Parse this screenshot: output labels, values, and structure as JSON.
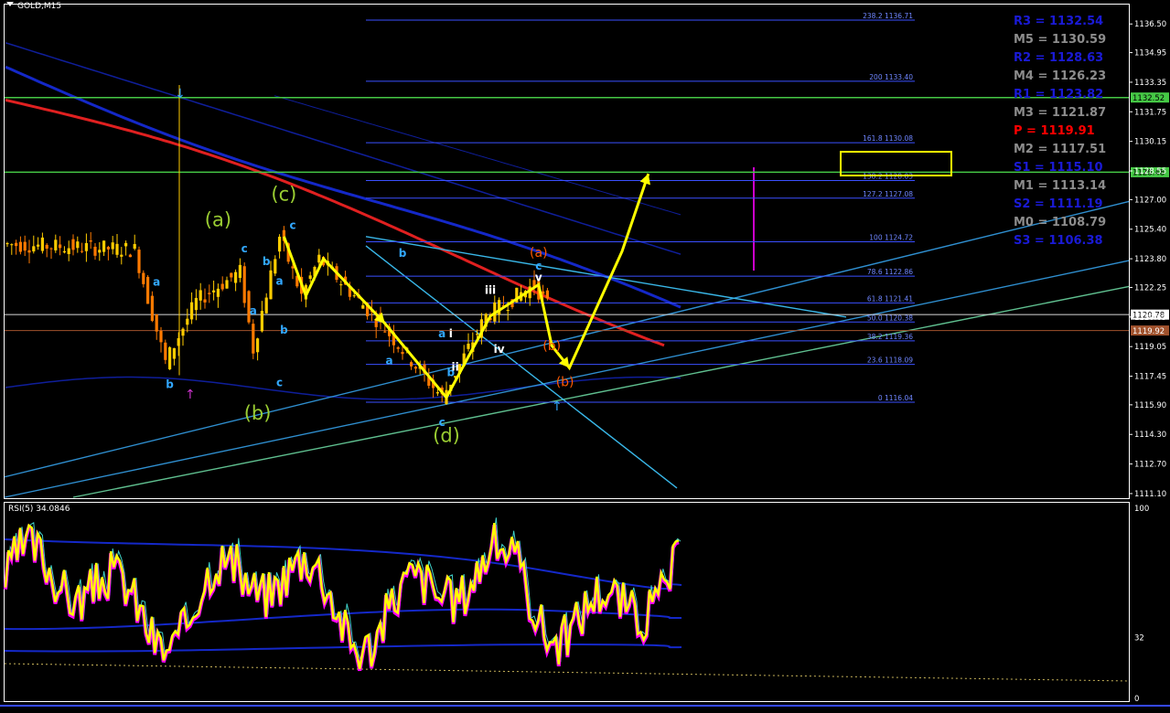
{
  "window": {
    "symbol_title": "GOLD,M15"
  },
  "colors": {
    "background": "#000000",
    "bull": "#ffcc00",
    "bear": "#ff7a00",
    "wave_path": "#ffff00",
    "ma_red": "#e02020",
    "ma_blue": "#1428c8",
    "fib": "#3a4fff",
    "channel": "#39b7e8",
    "green_level": "#45c845",
    "label_cyan": "#32a8ff",
    "label_green": "#9acd32",
    "label_orange": "#ff5a00",
    "rsi_main": "#ffff00",
    "rsi_magenta": "#ff00ff"
  },
  "chart_data": [
    {
      "type": "line",
      "title": "GOLD,M15",
      "xlabel": "",
      "ylabel": "",
      "ylim": [
        1110.9,
        1137.5
      ],
      "y_ticks": [
        "1136.50",
        "1134.95",
        "1133.35",
        "1131.75",
        "1130.15",
        "1128.55",
        "1127.00",
        "1125.40",
        "1123.80",
        "1122.25",
        "1120.65",
        "1119.05",
        "1117.45",
        "1115.90",
        "1114.30",
        "1112.70",
        "1111.10"
      ],
      "price_tags": [
        {
          "label": "1132.52",
          "value": 1132.52,
          "kind": "green-level"
        },
        {
          "label": "1128.48",
          "value": 1128.48,
          "kind": "green-level"
        },
        {
          "label": "1120.78",
          "value": 1120.78,
          "kind": "bid"
        },
        {
          "label": "1119.92",
          "value": 1119.92,
          "kind": "ask"
        }
      ],
      "fibonacci_levels": [
        {
          "label": "238.2 1136.71",
          "value": 1136.71
        },
        {
          "label": "200 1133.40",
          "value": 1133.4
        },
        {
          "label": "161.8 1130.08",
          "value": 1130.08
        },
        {
          "label": "138.2 1128.03",
          "value": 1128.03
        },
        {
          "label": "127.2 1127.08",
          "value": 1127.08
        },
        {
          "label": "100 1124.72",
          "value": 1124.72
        },
        {
          "label": "78.6 1122.86",
          "value": 1122.86
        },
        {
          "label": "61.8 1121.41",
          "value": 1121.41
        },
        {
          "label": "50.0 1120.38",
          "value": 1120.38
        },
        {
          "label": "38.2 1119.36",
          "value": 1119.36
        },
        {
          "label": "23.6 1118.09",
          "value": 1118.09
        },
        {
          "label": "0 1116.04",
          "value": 1116.04
        }
      ],
      "pivot_levels": [
        {
          "label": "R3 = 1132.54",
          "color": "#1a1ad6"
        },
        {
          "label": "M5 = 1130.59",
          "color": "#8c8c8c"
        },
        {
          "label": "R2 = 1128.63",
          "color": "#1a1ad6"
        },
        {
          "label": "M4 = 1126.23",
          "color": "#8c8c8c"
        },
        {
          "label": "R1 = 1123.82",
          "color": "#1a1ad6"
        },
        {
          "label": "M3 = 1121.87",
          "color": "#8c8c8c"
        },
        {
          "label": "P  = 1119.91",
          "color": "#ff0000"
        },
        {
          "label": "M2 = 1117.51",
          "color": "#8c8c8c"
        },
        {
          "label": "S1 = 1115.10",
          "color": "#1a1ad6"
        },
        {
          "label": "M1 = 1113.14",
          "color": "#8c8c8c"
        },
        {
          "label": "S2 = 1111.19",
          "color": "#1a1ad6"
        },
        {
          "label": "M0 = 1108.79",
          "color": "#8c8c8c"
        },
        {
          "label": "S3 = 1106.38",
          "color": "#1a1ad6"
        }
      ],
      "wave_labels": [
        {
          "text": "(a)",
          "bar": 48,
          "price": 1125.55,
          "color": "green",
          "size": "big"
        },
        {
          "text": "(b)",
          "bar": 57,
          "price": 1115.1,
          "color": "green",
          "size": "big"
        },
        {
          "text": "(c)",
          "bar": 63,
          "price": 1126.95,
          "color": "green",
          "size": "big"
        },
        {
          "text": "(d)",
          "bar": 100,
          "price": 1113.9,
          "color": "green",
          "size": "big"
        },
        {
          "text": "(a)",
          "bar": 121,
          "price": 1123.9,
          "color": "orange",
          "size": "mid"
        },
        {
          "text": "(b)",
          "bar": 124,
          "price": 1118.85,
          "color": "orange",
          "size": "mid"
        },
        {
          "text": "(b)",
          "bar": 127,
          "price": 1116.9,
          "color": "orange",
          "size": "mid"
        },
        {
          "text": "a",
          "bar": 34,
          "price": 1122.35,
          "color": "cyan",
          "size": "small"
        },
        {
          "text": "b",
          "bar": 37,
          "price": 1116.8,
          "color": "cyan",
          "size": "small"
        },
        {
          "text": "c",
          "bar": 54,
          "price": 1124.15,
          "color": "cyan",
          "size": "small"
        },
        {
          "text": "b",
          "bar": 59,
          "price": 1123.45,
          "color": "cyan",
          "size": "small"
        },
        {
          "text": "a",
          "bar": 56,
          "price": 1120.8,
          "color": "cyan",
          "size": "small"
        },
        {
          "text": "a",
          "bar": 62,
          "price": 1122.4,
          "color": "cyan",
          "size": "small"
        },
        {
          "text": "b",
          "bar": 63,
          "price": 1119.75,
          "color": "cyan",
          "size": "small"
        },
        {
          "text": "c",
          "bar": 62,
          "price": 1116.9,
          "color": "cyan",
          "size": "small"
        },
        {
          "text": "c",
          "bar": 65,
          "price": 1125.4,
          "color": "cyan",
          "size": "small"
        },
        {
          "text": "b",
          "bar": 90,
          "price": 1123.9,
          "color": "cyan",
          "size": "small"
        },
        {
          "text": "a",
          "bar": 87,
          "price": 1118.1,
          "color": "cyan",
          "size": "small"
        },
        {
          "text": "a",
          "bar": 99,
          "price": 1119.55,
          "color": "cyan",
          "size": "small"
        },
        {
          "text": "b",
          "bar": 101,
          "price": 1117.45,
          "color": "cyan",
          "size": "small"
        },
        {
          "text": "c",
          "bar": 99,
          "price": 1114.75,
          "color": "cyan",
          "size": "small"
        },
        {
          "text": "c",
          "bar": 121,
          "price": 1123.2,
          "color": "cyan",
          "size": "small"
        },
        {
          "text": "i",
          "bar": 101,
          "price": 1119.55,
          "color": "white",
          "size": "small"
        },
        {
          "text": "ii",
          "bar": 102,
          "price": 1117.75,
          "color": "white",
          "size": "small"
        },
        {
          "text": "iii",
          "bar": 110,
          "price": 1121.9,
          "color": "white",
          "size": "small"
        },
        {
          "text": "iv",
          "bar": 112,
          "price": 1118.7,
          "color": "white",
          "size": "small"
        },
        {
          "text": "v",
          "bar": 121,
          "price": 1122.6,
          "color": "white",
          "size": "small"
        }
      ]
    },
    {
      "type": "line",
      "title": "RSI(5) 34.0846",
      "series": [
        {
          "name": "RSI(5)",
          "last": 34.0846
        }
      ],
      "ylim": [
        0,
        100
      ],
      "y_ticks": [
        "100",
        "32",
        "0"
      ]
    }
  ]
}
